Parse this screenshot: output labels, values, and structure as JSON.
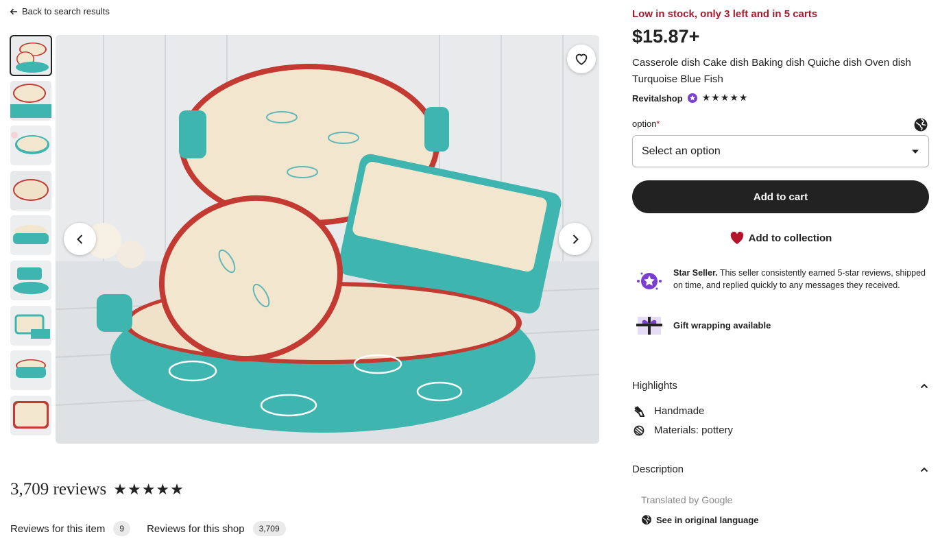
{
  "nav": {
    "back_label": "Back to search results"
  },
  "gallery": {
    "thumbnail_count": 9,
    "active_index": 0,
    "favorite_icon": "heart-outline-icon",
    "prev_icon": "chevron-left-icon",
    "next_icon": "chevron-right-icon"
  },
  "reviews": {
    "title": "3,709 reviews",
    "stars": "★★★★★",
    "tabs": [
      {
        "label": "Reviews for this item",
        "count": "9"
      },
      {
        "label": "Reviews for this shop",
        "count": "3,709"
      }
    ]
  },
  "listing": {
    "stock_notice": "Low in stock, only 3 left and in 5 carts",
    "price": "$15.87+",
    "title": "Casserole dish Cake dish Baking dish Quiche dish Oven dish Turquoise Blue Fish",
    "shop_name": "Revitalshop",
    "shop_stars": "★★★★★",
    "option_label": "option",
    "option_required_mark": "*",
    "select_placeholder": "Select an option",
    "add_to_cart": "Add to cart",
    "add_to_collection": "Add to collection",
    "star_seller_title": "Star Seller.",
    "star_seller_text": " This seller consistently earned 5-star reviews, shipped on time, and replied quickly to any messages they received.",
    "gift_wrap": "Gift wrapping available"
  },
  "highlights": {
    "heading": "Highlights",
    "items": [
      "Handmade",
      "Materials: pottery"
    ]
  },
  "description": {
    "heading": "Description",
    "translated_by": "Translated by Google",
    "see_original": "See in original language"
  },
  "colors": {
    "stock_red": "#a61a2e",
    "button_dark": "#222222",
    "star_seller_purple": "#7a3fd1",
    "heart_red": "#b3142b",
    "turquoise": "#3fb5b0",
    "rim_red": "#c23a32",
    "cream": "#f3e6cf"
  }
}
